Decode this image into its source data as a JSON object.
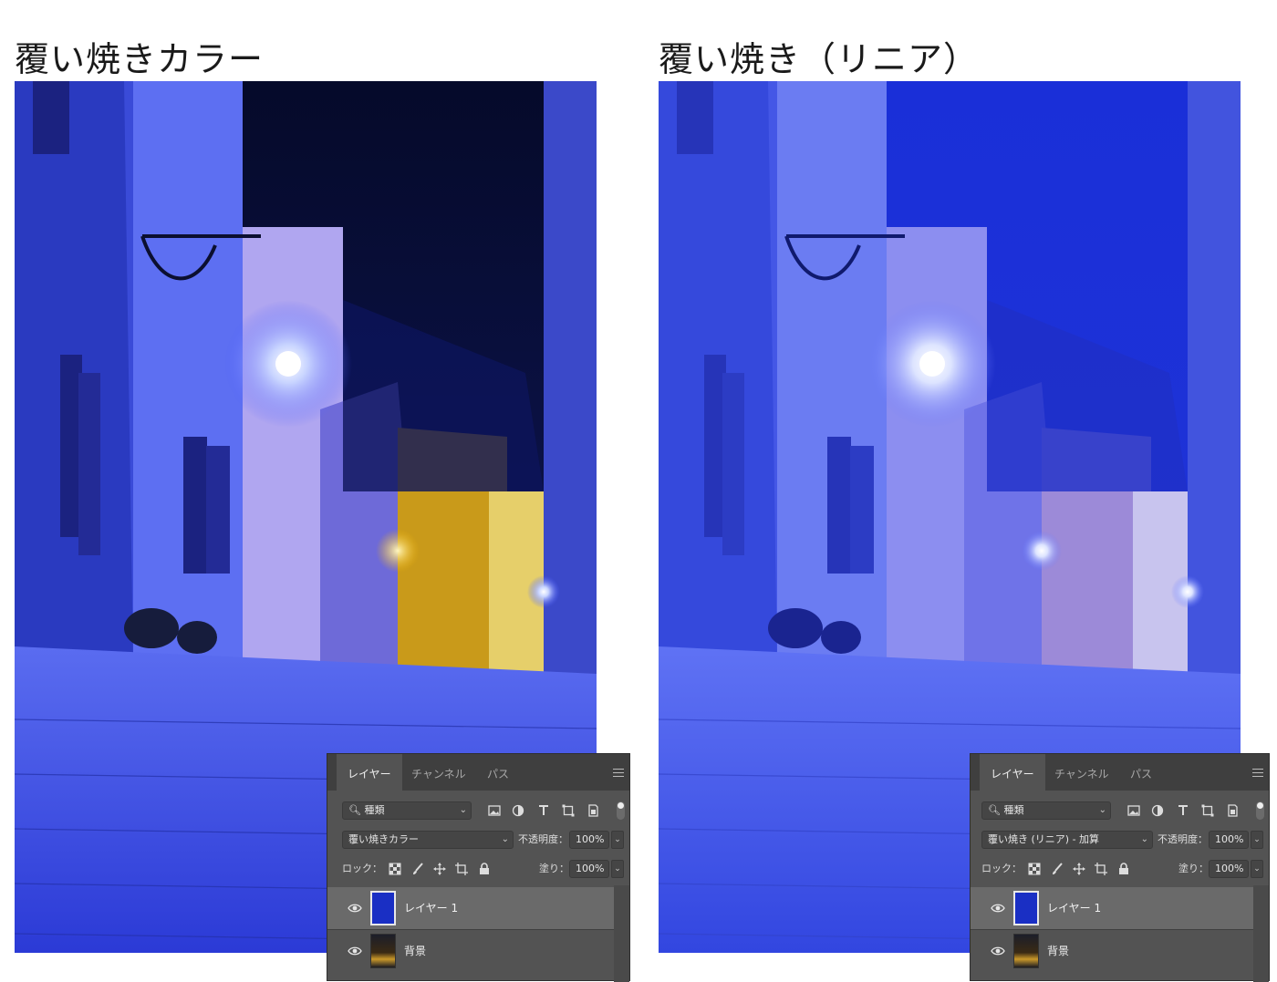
{
  "panels": [
    {
      "title": "覆い焼きカラー",
      "photo_variant": "color_dodge",
      "layers_panel": {
        "tabs": [
          "レイヤー",
          "チャンネル",
          "パス"
        ],
        "active_tab": "レイヤー",
        "filter_label": "種類",
        "blend_mode": "覆い焼きカラー",
        "opacity_label": "不透明度：",
        "opacity_value": "100%",
        "lock_label": "ロック：",
        "fill_label": "塗り：",
        "fill_value": "100%",
        "layers": [
          {
            "name": "レイヤー 1",
            "thumb": "solid",
            "thumb_color": "#1a2fc4",
            "visible": true,
            "selected": true
          },
          {
            "name": "背景",
            "thumb": "photo",
            "visible": true,
            "selected": false
          }
        ]
      }
    },
    {
      "title": "覆い焼き（リニア）",
      "photo_variant": "linear_dodge",
      "layers_panel": {
        "tabs": [
          "レイヤー",
          "チャンネル",
          "パス"
        ],
        "active_tab": "レイヤー",
        "filter_label": "種類",
        "blend_mode": "覆い焼き (リニア) - 加算",
        "opacity_label": "不透明度：",
        "opacity_value": "100%",
        "lock_label": "ロック：",
        "fill_label": "塗り：",
        "fill_value": "100%",
        "layers": [
          {
            "name": "レイヤー 1",
            "thumb": "solid",
            "thumb_color": "#1a2fc4",
            "visible": true,
            "selected": true
          },
          {
            "name": "背景",
            "thumb": "photo",
            "visible": true,
            "selected": false
          }
        ]
      }
    }
  ],
  "icons": {
    "filter": "search-icon",
    "image_filter": "image-icon",
    "adjustment_filter": "adjustment-icon",
    "type_filter": "type-icon",
    "shape_filter": "shape-icon",
    "smart_filter": "smart-object-icon",
    "lock_transparent": "checkerboard-icon",
    "lock_image": "brush-icon",
    "lock_position": "move-icon",
    "lock_artboard": "artboard-icon",
    "lock_all": "lock-icon",
    "visibility": "eye-icon"
  }
}
